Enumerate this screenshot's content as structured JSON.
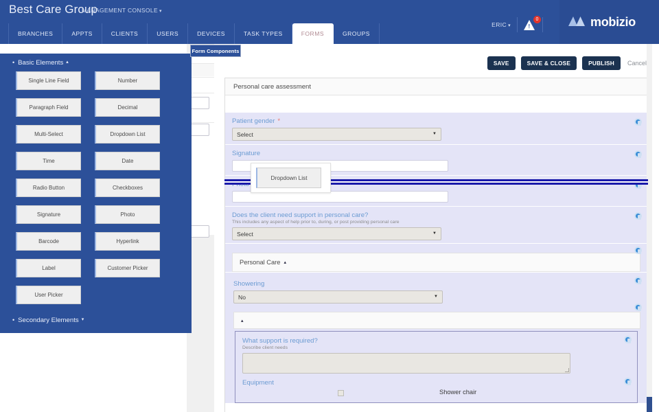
{
  "topbar": {
    "brand": "Best Care Group",
    "console_label": "MANAGEMENT CONSOLE",
    "caret": "▾",
    "user": "ERIC",
    "user_caret": "▾",
    "alert_count": "0",
    "alert_glyph": "!",
    "logo_text": "mobizio",
    "accent_blue": "#2c5099",
    "nav": [
      {
        "label": "BRANCHES",
        "active": false
      },
      {
        "label": "APPTS",
        "active": false
      },
      {
        "label": "CLIENTS",
        "active": false
      },
      {
        "label": "USERS",
        "active": false
      },
      {
        "label": "DEVICES",
        "active": false
      },
      {
        "label": "TASK TYPES",
        "active": false
      },
      {
        "label": "FORMS",
        "active": true
      },
      {
        "label": "GROUPS",
        "active": false
      }
    ]
  },
  "components_panel": {
    "tab_label": "Form Components",
    "basic_section": {
      "label": "Basic Elements",
      "bullet": "•",
      "caret": "▴"
    },
    "secondary_section": {
      "label": "Secondary Elements",
      "bullet": "•",
      "caret": "▾"
    },
    "elements": [
      {
        "label": "Single Line Field"
      },
      {
        "label": "Number"
      },
      {
        "label": "Paragraph Field"
      },
      {
        "label": "Decimal"
      },
      {
        "label": "Multi-Select"
      },
      {
        "label": "Dropdown List"
      },
      {
        "label": "Time"
      },
      {
        "label": "Date"
      },
      {
        "label": "Radio Button"
      },
      {
        "label": "Checkboxes"
      },
      {
        "label": "Signature"
      },
      {
        "label": "Photo"
      },
      {
        "label": "Barcode"
      },
      {
        "label": "Hyperlink"
      },
      {
        "label": "Label"
      },
      {
        "label": "Customer Picker"
      },
      {
        "label": "User Picker"
      }
    ]
  },
  "drag": {
    "dragged_label": "Dropdown List"
  },
  "toolbar": {
    "save": "SAVE",
    "save_close": "SAVE & CLOSE",
    "publish": "PUBLISH",
    "cancel": "Cancel"
  },
  "form": {
    "title": "Personal care assessment",
    "fields": {
      "patient_gender": {
        "label": "Patient gender",
        "required_mark": "*",
        "value": "Select",
        "arrow": "▼"
      },
      "signature": {
        "label": "Signature"
      },
      "photo": {
        "label": "Photo"
      },
      "support_question": {
        "label": "Does the client need support in personal care?",
        "sub": "This includes any aspect of help prior to, during, or post providing personal care",
        "value": "Select",
        "arrow": "▼"
      },
      "personal_care_section": {
        "label": "Personal Care",
        "caret": "▴"
      },
      "showering": {
        "label": "Showering",
        "value": "No",
        "arrow": "▼"
      },
      "empty_section": {
        "caret": "▴"
      },
      "what_support": {
        "label": "What support is required?",
        "sub": "Describe client needs",
        "value": ""
      },
      "equipment": {
        "label": "Equipment",
        "options": [
          {
            "label": "Shower chair",
            "checked": false
          }
        ]
      }
    }
  }
}
